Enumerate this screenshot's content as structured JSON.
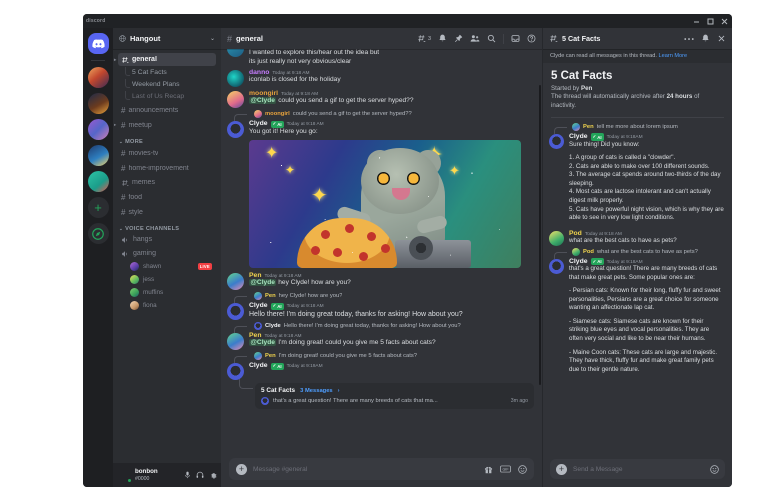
{
  "window": {
    "watermark": "discord",
    "controls": [
      "minimize",
      "maximize",
      "close"
    ]
  },
  "colors": {
    "brand": "#5865f2",
    "accent_link": "#4e9eff",
    "online": "#23a55a",
    "live": "#f23f43",
    "bg_chat": "#313338",
    "bg_sidebar": "#2b2d31",
    "bg_rail": "#1e1f22",
    "bg_active_channel": "#404249",
    "text_normal": "#dbdee1",
    "text_muted": "#949ba4"
  },
  "rail": {
    "home_label": "discord-home",
    "servers": [
      {
        "name": "server-1",
        "has_unread_pill": false
      },
      {
        "name": "server-2",
        "has_unread_pill": true
      },
      {
        "name": "server-3",
        "has_unread_pill": true
      },
      {
        "name": "server-4",
        "has_unread_pill": false
      },
      {
        "name": "server-5",
        "has_unread_pill": true
      },
      {
        "name": "server-6",
        "has_unread_pill": false
      }
    ],
    "add_server_label": "+",
    "explore_label": "explore-servers"
  },
  "sidebar": {
    "server_name": "Hangout",
    "categories": [
      {
        "label": "",
        "channels": [
          {
            "name": "general",
            "type": "text-threads",
            "active": true,
            "threads": [
              {
                "name": "5 Cat Facts",
                "muted": false
              },
              {
                "name": "Weekend Plans",
                "muted": false
              },
              {
                "name": "Last of Us Recap",
                "muted": true
              }
            ]
          },
          {
            "name": "announcements",
            "type": "text",
            "active": false,
            "threads": []
          },
          {
            "name": "meetup",
            "type": "text",
            "active": false,
            "threads": []
          }
        ]
      },
      {
        "label": "MORE",
        "channels": [
          {
            "name": "movies-tv",
            "type": "text",
            "active": false,
            "threads": []
          },
          {
            "name": "home-improvement",
            "type": "text",
            "active": false,
            "threads": []
          },
          {
            "name": "memes",
            "type": "text-threads",
            "active": false,
            "threads": []
          },
          {
            "name": "food",
            "type": "text",
            "active": false,
            "threads": []
          },
          {
            "name": "style",
            "type": "text",
            "active": false,
            "threads": []
          }
        ]
      },
      {
        "label": "VOICE CHANNELS",
        "voice": [
          {
            "name": "hangs",
            "members": []
          },
          {
            "name": "gaming",
            "members": [
              {
                "name": "shawn",
                "live": true,
                "live_label": "LIVE"
              },
              {
                "name": "jess",
                "live": false
              },
              {
                "name": "muffins",
                "live": false
              },
              {
                "name": "fiona",
                "live": false
              }
            ]
          }
        ]
      }
    ],
    "user": {
      "name": "bonbon",
      "tag": "#0000",
      "status": "online",
      "controls": [
        "mic-icon",
        "headset-icon",
        "settings-gear-icon"
      ]
    }
  },
  "channel_header": {
    "channel_name": "general",
    "thread_count": "3",
    "icons": [
      "threads-icon",
      "bell-icon",
      "pin-icon",
      "members-icon",
      "search-icon",
      "inbox-icon",
      "help-icon"
    ]
  },
  "messages": [
    {
      "type": "continuation",
      "author": "",
      "lines": [
        "I wanted to explore this/hear out the idea but",
        "its just really not very obvious/clear"
      ]
    },
    {
      "type": "message",
      "author": "danno",
      "author_color": "#c77dff",
      "timestamp": "Today at 9:18 AM",
      "lines": [
        "iconlab is closed for the holiday"
      ]
    },
    {
      "type": "message",
      "author": "moongirl",
      "author_color": "#e8a33d",
      "timestamp": "Today at 9:18 AM",
      "mention": "@Clyde",
      "lines": [
        "could you send a gif to get the server hyped??"
      ]
    },
    {
      "type": "reply-ref",
      "author": "moongirl",
      "author_color": "#e8a33d",
      "text": "could you send a gif to get the server hyped??"
    },
    {
      "type": "message",
      "author": "Clyde",
      "author_color": "#f2f3f5",
      "badge": "AI",
      "timestamp": "Today at 9:18 AM",
      "lines": [
        "You got it! Here you go:"
      ],
      "attachment": "space-cat-dj-pizza-gif"
    },
    {
      "type": "message",
      "author": "Pen",
      "author_color": "#f2d54e",
      "timestamp": "Today at 9:18 AM",
      "mention": "@Clyde",
      "lines": [
        "hey Clyde! how are you?"
      ]
    },
    {
      "type": "reply-ref",
      "author": "Pen",
      "author_color": "#f2d54e",
      "text": "hey Clyde! how are you?"
    },
    {
      "type": "message",
      "author": "Clyde",
      "author_color": "#f2f3f5",
      "badge": "AI",
      "timestamp": "Today at 9:18 AM",
      "lines": [
        "Hello there! I'm doing great today, thanks for asking! How about you?"
      ]
    },
    {
      "type": "reply-ref",
      "author": "Clyde",
      "author_color": "#f2f3f5",
      "text": "Hello there! I'm doing great today, thanks for asking! How about you?"
    },
    {
      "type": "message",
      "author": "Pen",
      "author_color": "#f2d54e",
      "timestamp": "Today at 9:18 AM",
      "mention": "@Clyde",
      "lines": [
        "I'm doing great! could you give me 5 facts about cats?"
      ]
    },
    {
      "type": "reply-ref",
      "author": "Pen",
      "author_color": "#f2d54e",
      "text": "I'm doing great! could you give me 5 facts about cats?"
    },
    {
      "type": "message",
      "author": "Clyde",
      "author_color": "#f2f3f5",
      "badge": "AI",
      "timestamp": "Today at 9:19AM",
      "lines": [],
      "thread_card": {
        "name": "5 Cat Facts",
        "count": "3 Messages",
        "chevron": "›",
        "preview": "that's a great question! There are many breeds of cats that ma...",
        "ago": "3m ago"
      }
    }
  ],
  "composer": {
    "placeholder": "Message #general",
    "plus_label": "+",
    "icons": [
      "gift-icon",
      "gif-icon",
      "emoji-icon"
    ]
  },
  "thread_panel": {
    "title": "5 Cat Facts",
    "header_icons": [
      "more-icon",
      "bell-icon",
      "close-icon"
    ],
    "notice": "Clyde can read all messages in this thread.",
    "notice_link": "Learn More",
    "heading": "5 Cat Facts",
    "started_by_label": "Started by",
    "started_by": "Pen",
    "archive_text_1": "The thread will automatically archive after",
    "archive_duration": "24 hours",
    "archive_text_2": "of inactivity.",
    "messages": [
      {
        "type": "reply-ref",
        "author": "Pen",
        "author_color": "#f2d54e",
        "text": "tell me more about lorem ipsum"
      },
      {
        "type": "message",
        "author": "Clyde",
        "author_color": "#f2f3f5",
        "badge": "AI",
        "timestamp": "Today at 9:18AM",
        "lines": [
          "Sure thing! Did you know:"
        ],
        "list": [
          "1. A group of cats is called a \"clowder\".",
          "2. Cats are able to make over 100 different sounds.",
          " 3. The average cat spends around two-thirds of the day sleeping.",
          "4. Most cats are lactose intolerant and can't actually digest milk properly.",
          "5. Cats have powerful night vision, which is why they are able to see in very low light conditions."
        ]
      },
      {
        "type": "message",
        "author": "Pod",
        "author_color": "#f2d54e",
        "timestamp": "Today at 9:18 AM",
        "lines": [
          "what are the best cats to have as pets?"
        ]
      },
      {
        "type": "reply-ref",
        "author": "Pod",
        "author_color": "#f2d54e",
        "text": "what are the best cats to have as pets?"
      },
      {
        "type": "message",
        "author": "Clyde",
        "author_color": "#f2f3f5",
        "badge": "AI",
        "timestamp": "Today at 9:18AM",
        "lines": [
          "that's a great question! There are many breeds of cats that make great pets. Some popular ones are:"
        ],
        "paragraphs": [
          "- Persian cats: Known for their long, fluffy fur and sweet personalities, Persians are a great choice for someone wanting an affectionate lap cat.",
          "- Siamese cats: Siamese cats are known for their striking blue eyes and vocal personalities. They are often very social and like to be near their humans.",
          "- Maine Coon cats: These cats are large and majestic. They have thick, fluffy fur and make great family pets due to their gentle nature."
        ]
      }
    ],
    "composer": {
      "placeholder": "Send a Message",
      "plus_label": "+",
      "icons": [
        "emoji-icon"
      ]
    }
  }
}
